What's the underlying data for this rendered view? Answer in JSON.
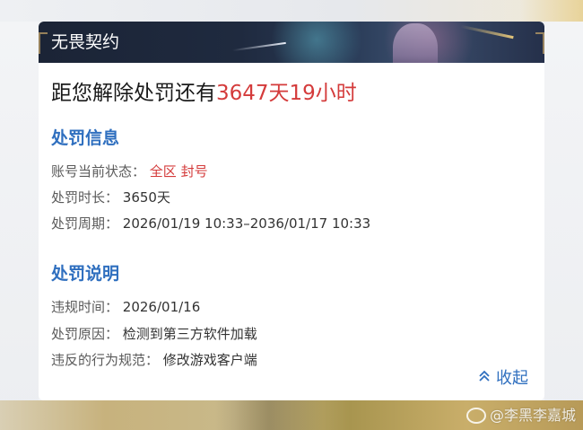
{
  "banner": {
    "title": "无畏契约"
  },
  "headline": {
    "prefix": "距您解除处罚还有",
    "remaining": "3647天19小时"
  },
  "penalty_info": {
    "title": "处罚信息",
    "rows": [
      {
        "label": "账号当前状态：",
        "value": "全区 封号"
      },
      {
        "label": "处罚时长：",
        "value": "3650天"
      },
      {
        "label": "处罚周期：",
        "value": "2026/01/19 10:33–2036/01/17 10:33"
      }
    ]
  },
  "penalty_desc": {
    "title": "处罚说明",
    "rows": [
      {
        "label": "违规时间：",
        "value": "2026/01/16"
      },
      {
        "label": "处罚原因：",
        "value": "检测到第三方软件加载"
      },
      {
        "label": "违反的行为规范：",
        "value": "修改游戏客户端"
      }
    ]
  },
  "collapse": {
    "label": "收起",
    "icon": "double-chevron-up-icon"
  },
  "watermark": {
    "text": "@李黑李嘉城",
    "icon": "weibo-icon"
  },
  "colors": {
    "accent_blue": "#2f6fbf",
    "alert_red": "#d43b3b",
    "banner_dark": "#1b2436"
  }
}
